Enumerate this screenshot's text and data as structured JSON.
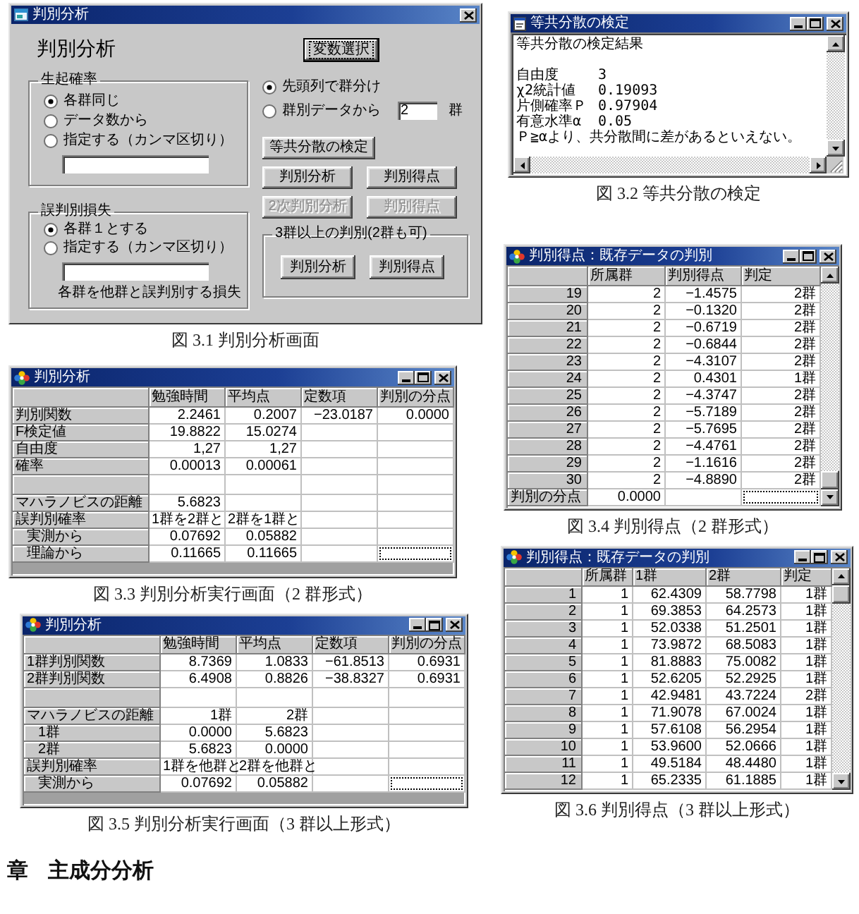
{
  "figures": [
    {
      "kind": "dialog",
      "title": "判別分析",
      "heading": "判別分析",
      "select_button": {
        "label": "変数選択",
        "focused": true
      },
      "occurrence": {
        "legend": "生起確率",
        "options": [
          {
            "label": "各群同じ",
            "selected": true
          },
          {
            "label": "データ数から",
            "selected": false
          },
          {
            "label": "指定する（カンマ区切り）",
            "selected": false
          }
        ]
      },
      "loss": {
        "legend": "誤判別損失",
        "options": [
          {
            "label": "各群１とする",
            "selected": true
          },
          {
            "label": "指定する（カンマ区切り）",
            "selected": false
          }
        ],
        "note": "各群を他群と誤判別する損失"
      },
      "grouping": [
        {
          "label": "先頭列で群分け",
          "selected": true
        },
        {
          "label": "群別データから",
          "selected": false
        }
      ],
      "group_count": {
        "value": "2",
        "unit": "群"
      },
      "buttons": [
        {
          "label": "等共分散の検定",
          "disabled": false
        },
        {
          "label": "判別分析",
          "disabled": false
        },
        {
          "label": "判別得点",
          "disabled": false
        },
        {
          "label": "2次判別分析",
          "disabled": true
        },
        {
          "label": "判別得点",
          "disabled": true
        }
      ],
      "multi_group": {
        "legend": "3群以上の判別(2群も可)",
        "buttons": [
          {
            "label": "判別分析",
            "disabled": false
          },
          {
            "label": "判別得点",
            "disabled": false
          }
        ]
      },
      "caption": "図 3.1 判別分析画面"
    },
    {
      "kind": "text",
      "title": "等共分散の検定",
      "heading": "等共分散の検定結果",
      "results": [
        {
          "label": "自由度",
          "value": "3"
        },
        {
          "label": "χ2統計値",
          "value": "0.19093"
        },
        {
          "label": "片側確率Ｐ",
          "value": "0.97904"
        },
        {
          "label": "有意水準α",
          "value": "0.05"
        }
      ],
      "conclusion": "Ｐ≧αより、共分散間に差があるといえない。",
      "caption": "図 3.2 等共分散の検定"
    },
    {
      "kind": "table",
      "title": "判別分析",
      "columns": [
        "勉強時間",
        "平均点",
        "定数項",
        "判別の分点"
      ],
      "rows": [
        {
          "kind": "data",
          "label": "判別関数",
          "cells": [
            "2.2461",
            "0.2007",
            "−23.0187",
            "0.0000"
          ],
          "focused": false
        },
        {
          "kind": "data",
          "label": "F検定値",
          "cells": [
            "19.8822",
            "15.0274"
          ],
          "focused": false
        },
        {
          "kind": "data",
          "label": "自由度",
          "cells": [
            "1,27",
            "1,27"
          ],
          "focused": false
        },
        {
          "kind": "data",
          "label": "確率",
          "cells": [
            "0.00013",
            "0.00061"
          ],
          "focused": false
        },
        {
          "kind": "spacer",
          "focused": false
        },
        {
          "kind": "data",
          "label": "マハラノビスの距離",
          "cells": [
            "5.6823"
          ],
          "focused": false
        },
        {
          "kind": "data",
          "label": "誤判別確率",
          "cells": [
            "1群を2群と",
            "2群を1群と"
          ],
          "focused": false,
          "children": [
            {
              "kind": "data",
              "label": "実測から",
              "cells": [
                "0.07692",
                "0.05882"
              ],
              "focused": false
            },
            {
              "kind": "data",
              "label": "理論から",
              "cells": [
                "0.11665",
                "0.11665"
              ],
              "focused": true
            }
          ]
        }
      ],
      "caption": "図 3.3 判別分析実行画面（2 群形式）"
    },
    {
      "kind": "scrolltable",
      "title": "判別得点：既存データの判別",
      "columns": [
        "所属群",
        "判別得点",
        "判定"
      ],
      "rows": [
        {
          "kind": "data",
          "label": "19",
          "cells": [
            "2",
            "−1.4575",
            "2群"
          ],
          "focused": false
        },
        {
          "kind": "data",
          "label": "20",
          "cells": [
            "2",
            "−0.1320",
            "2群"
          ],
          "focused": false
        },
        {
          "kind": "data",
          "label": "21",
          "cells": [
            "2",
            "−0.6719",
            "2群"
          ],
          "focused": false
        },
        {
          "kind": "data",
          "label": "22",
          "cells": [
            "2",
            "−0.6844",
            "2群"
          ],
          "focused": false
        },
        {
          "kind": "data",
          "label": "23",
          "cells": [
            "2",
            "−4.3107",
            "2群"
          ],
          "focused": false
        },
        {
          "kind": "data",
          "label": "24",
          "cells": [
            "2",
            "0.4301",
            "1群"
          ],
          "focused": false
        },
        {
          "kind": "data",
          "label": "25",
          "cells": [
            "2",
            "−4.3747",
            "2群"
          ],
          "focused": false
        },
        {
          "kind": "data",
          "label": "26",
          "cells": [
            "2",
            "−5.7189",
            "2群"
          ],
          "focused": false
        },
        {
          "kind": "data",
          "label": "27",
          "cells": [
            "2",
            "−5.7695",
            "2群"
          ],
          "focused": false
        },
        {
          "kind": "data",
          "label": "28",
          "cells": [
            "2",
            "−4.4761",
            "2群"
          ],
          "focused": false
        },
        {
          "kind": "data",
          "label": "29",
          "cells": [
            "2",
            "−1.1616",
            "2群"
          ],
          "focused": false
        },
        {
          "kind": "data",
          "label": "30",
          "cells": [
            "2",
            "−4.8890",
            "2群"
          ],
          "focused": false
        },
        {
          "kind": "footer",
          "label": "判別の分点",
          "cells": [
            "0.0000"
          ],
          "focused": true
        }
      ],
      "caption": "図 3.4 判別得点（2 群形式）"
    },
    {
      "kind": "table",
      "title": "判別分析",
      "columns": [
        "勉強時間",
        "平均点",
        "定数項",
        "判別の分点"
      ],
      "rows": [
        {
          "kind": "data",
          "label": "1群判別関数",
          "cells": [
            "8.7369",
            "1.0833",
            "−61.8513",
            "0.6931"
          ],
          "focused": false
        },
        {
          "kind": "data",
          "label": "2群判別関数",
          "cells": [
            "6.4908",
            "0.8826",
            "−38.8327",
            "0.6931"
          ],
          "focused": false
        },
        {
          "kind": "spacer",
          "focused": false
        },
        {
          "kind": "data",
          "label": "マハラノビスの距離",
          "cells": [
            "1群",
            "2群"
          ],
          "focused": false,
          "children": [
            {
              "kind": "data",
              "label": "1群",
              "cells": [
                "0.0000",
                "5.6823"
              ],
              "focused": false
            },
            {
              "kind": "data",
              "label": "2群",
              "cells": [
                "5.6823",
                "0.0000"
              ],
              "focused": false
            }
          ]
        },
        {
          "kind": "data",
          "label": "誤判別確率",
          "cells": [
            "1群を他群と",
            "2群を他群と"
          ],
          "focused": false,
          "children": [
            {
              "kind": "data",
              "label": "実測から",
              "cells": [
                "0.07692",
                "0.05882"
              ],
              "focused": true
            }
          ]
        }
      ],
      "caption": "図 3.5 判別分析実行画面（3 群以上形式）"
    },
    {
      "kind": "scrolltable",
      "title": "判別得点：既存データの判別",
      "columns": [
        "所属群",
        "1群",
        "2群",
        "判定"
      ],
      "rows": [
        {
          "kind": "data",
          "label": "1",
          "cells": [
            "1",
            "62.4309",
            "58.7798",
            "1群"
          ]
        },
        {
          "kind": "data",
          "label": "2",
          "cells": [
            "1",
            "69.3853",
            "64.2573",
            "1群"
          ]
        },
        {
          "kind": "data",
          "label": "3",
          "cells": [
            "1",
            "52.0338",
            "51.2501",
            "1群"
          ]
        },
        {
          "kind": "data",
          "label": "4",
          "cells": [
            "1",
            "73.9872",
            "68.5083",
            "1群"
          ]
        },
        {
          "kind": "data",
          "label": "5",
          "cells": [
            "1",
            "81.8883",
            "75.0082",
            "1群"
          ]
        },
        {
          "kind": "data",
          "label": "6",
          "cells": [
            "1",
            "52.6205",
            "52.2925",
            "1群"
          ]
        },
        {
          "kind": "data",
          "label": "7",
          "cells": [
            "1",
            "42.9481",
            "43.7224",
            "2群"
          ]
        },
        {
          "kind": "data",
          "label": "8",
          "cells": [
            "1",
            "71.9078",
            "67.0024",
            "1群"
          ]
        },
        {
          "kind": "data",
          "label": "9",
          "cells": [
            "1",
            "57.6108",
            "56.2954",
            "1群"
          ]
        },
        {
          "kind": "data",
          "label": "10",
          "cells": [
            "1",
            "53.9600",
            "52.0666",
            "1群"
          ]
        },
        {
          "kind": "data",
          "label": "11",
          "cells": [
            "1",
            "49.5184",
            "48.4480",
            "1群"
          ]
        },
        {
          "kind": "data",
          "label": "12",
          "cells": [
            "1",
            "65.2335",
            "61.1885",
            "1群"
          ]
        }
      ],
      "caption": "図 3.6 判別得点（3 群以上形式）"
    }
  ],
  "section_heading": "章 主成分分析"
}
